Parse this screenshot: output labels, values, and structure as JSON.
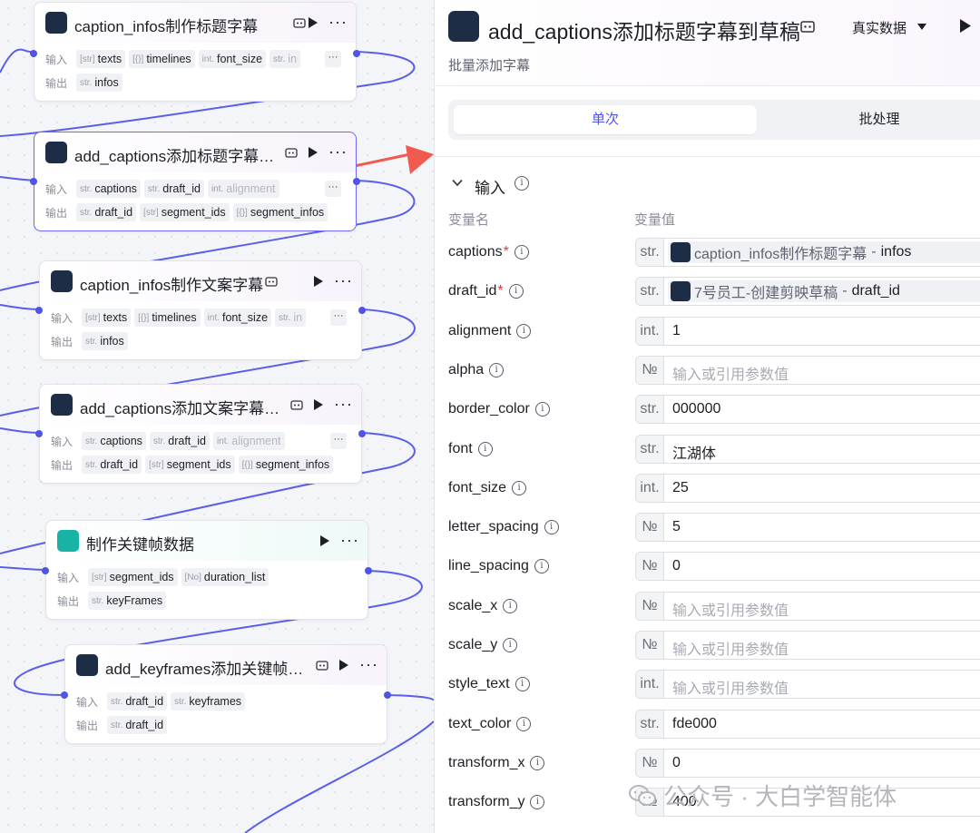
{
  "canvas": {
    "nodes": [
      {
        "title": "caption_infos制作标题字幕",
        "in_label": "输入",
        "out_label": "输出",
        "inputs": [
          {
            "type": "[str]",
            "name": "texts"
          },
          {
            "type": "[{}]",
            "name": "timelines"
          },
          {
            "type": "int.",
            "name": "font_size"
          },
          {
            "type": "str.",
            "name": "in"
          }
        ],
        "outputs": [
          {
            "type": "str.",
            "name": "infos"
          }
        ]
      },
      {
        "title": "add_captions添加标题字幕…",
        "in_label": "输入",
        "out_label": "输出",
        "inputs": [
          {
            "type": "str.",
            "name": "captions"
          },
          {
            "type": "str.",
            "name": "draft_id"
          },
          {
            "type": "int.",
            "name": "alignment"
          }
        ],
        "outputs": [
          {
            "type": "str.",
            "name": "draft_id"
          },
          {
            "type": "[str]",
            "name": "segment_ids"
          },
          {
            "type": "[{}]",
            "name": "segment_infos"
          }
        ]
      },
      {
        "title": "caption_infos制作文案字幕",
        "in_label": "输入",
        "out_label": "输出",
        "inputs": [
          {
            "type": "[str]",
            "name": "texts"
          },
          {
            "type": "[{}]",
            "name": "timelines"
          },
          {
            "type": "int.",
            "name": "font_size"
          },
          {
            "type": "str.",
            "name": "in"
          }
        ],
        "outputs": [
          {
            "type": "str.",
            "name": "infos"
          }
        ]
      },
      {
        "title": "add_captions添加文案字幕…",
        "in_label": "输入",
        "out_label": "输出",
        "inputs": [
          {
            "type": "str.",
            "name": "captions"
          },
          {
            "type": "str.",
            "name": "draft_id"
          },
          {
            "type": "int.",
            "name": "alignment"
          }
        ],
        "outputs": [
          {
            "type": "str.",
            "name": "draft_id"
          },
          {
            "type": "[str]",
            "name": "segment_ids"
          },
          {
            "type": "[{}]",
            "name": "segment_infos"
          }
        ]
      },
      {
        "title": "制作关键帧数据",
        "in_label": "输入",
        "out_label": "输出",
        "inputs": [
          {
            "type": "[str]",
            "name": "segment_ids"
          },
          {
            "type": "[No]",
            "name": "duration_list"
          }
        ],
        "outputs": [
          {
            "type": "str.",
            "name": "keyFrames"
          }
        ]
      },
      {
        "title": "add_keyframes添加关键帧…",
        "in_label": "输入",
        "out_label": "输出",
        "inputs": [
          {
            "type": "str.",
            "name": "draft_id"
          },
          {
            "type": "str.",
            "name": "keyframes"
          }
        ],
        "outputs": [
          {
            "type": "str.",
            "name": "draft_id"
          }
        ]
      }
    ],
    "more_glyph": "···",
    "more_chip": "···"
  },
  "panel": {
    "title": "add_captions添加标题字幕到草稿",
    "subtitle": "批量添加字幕",
    "data_mode": "真实数据",
    "tabs": [
      "单次",
      "批处理"
    ],
    "section_title": "输入",
    "col_name": "变量名",
    "col_value": "变量值",
    "params": [
      {
        "name": "captions",
        "required": true,
        "type": "str.",
        "ref_node": "caption_infos制作标题字幕",
        "ref_var": "infos"
      },
      {
        "name": "draft_id",
        "required": true,
        "type": "str.",
        "ref_node": "7号员工-创建剪映草稿",
        "ref_var": "draft_id"
      },
      {
        "name": "alignment",
        "type": "int.",
        "value": "1"
      },
      {
        "name": "alpha",
        "type": "№",
        "placeholder": "输入或引用参数值"
      },
      {
        "name": "border_color",
        "type": "str.",
        "value": "000000"
      },
      {
        "name": "font",
        "type": "str.",
        "value": "江湖体"
      },
      {
        "name": "font_size",
        "type": "int.",
        "value": "25"
      },
      {
        "name": "letter_spacing",
        "type": "№",
        "value": "5"
      },
      {
        "name": "line_spacing",
        "type": "№",
        "value": "0"
      },
      {
        "name": "scale_x",
        "type": "№",
        "placeholder": "输入或引用参数值"
      },
      {
        "name": "scale_y",
        "type": "№",
        "placeholder": "输入或引用参数值"
      },
      {
        "name": "style_text",
        "type": "int.",
        "placeholder": "输入或引用参数值"
      },
      {
        "name": "text_color",
        "type": "str.",
        "value": "fde000"
      },
      {
        "name": "transform_x",
        "type": "№",
        "value": "0"
      },
      {
        "name": "transform_y",
        "type": "№",
        "value": "400"
      }
    ],
    "ref_separator": "-",
    "required_mark": "*",
    "info_glyph": "i"
  },
  "watermark": "公众号 · 大白学智能体",
  "colors": {
    "accent": "#4d53e8",
    "wire": "#5b5fe8",
    "arrow": "#f05a4f",
    "required": "#e03b3b"
  }
}
